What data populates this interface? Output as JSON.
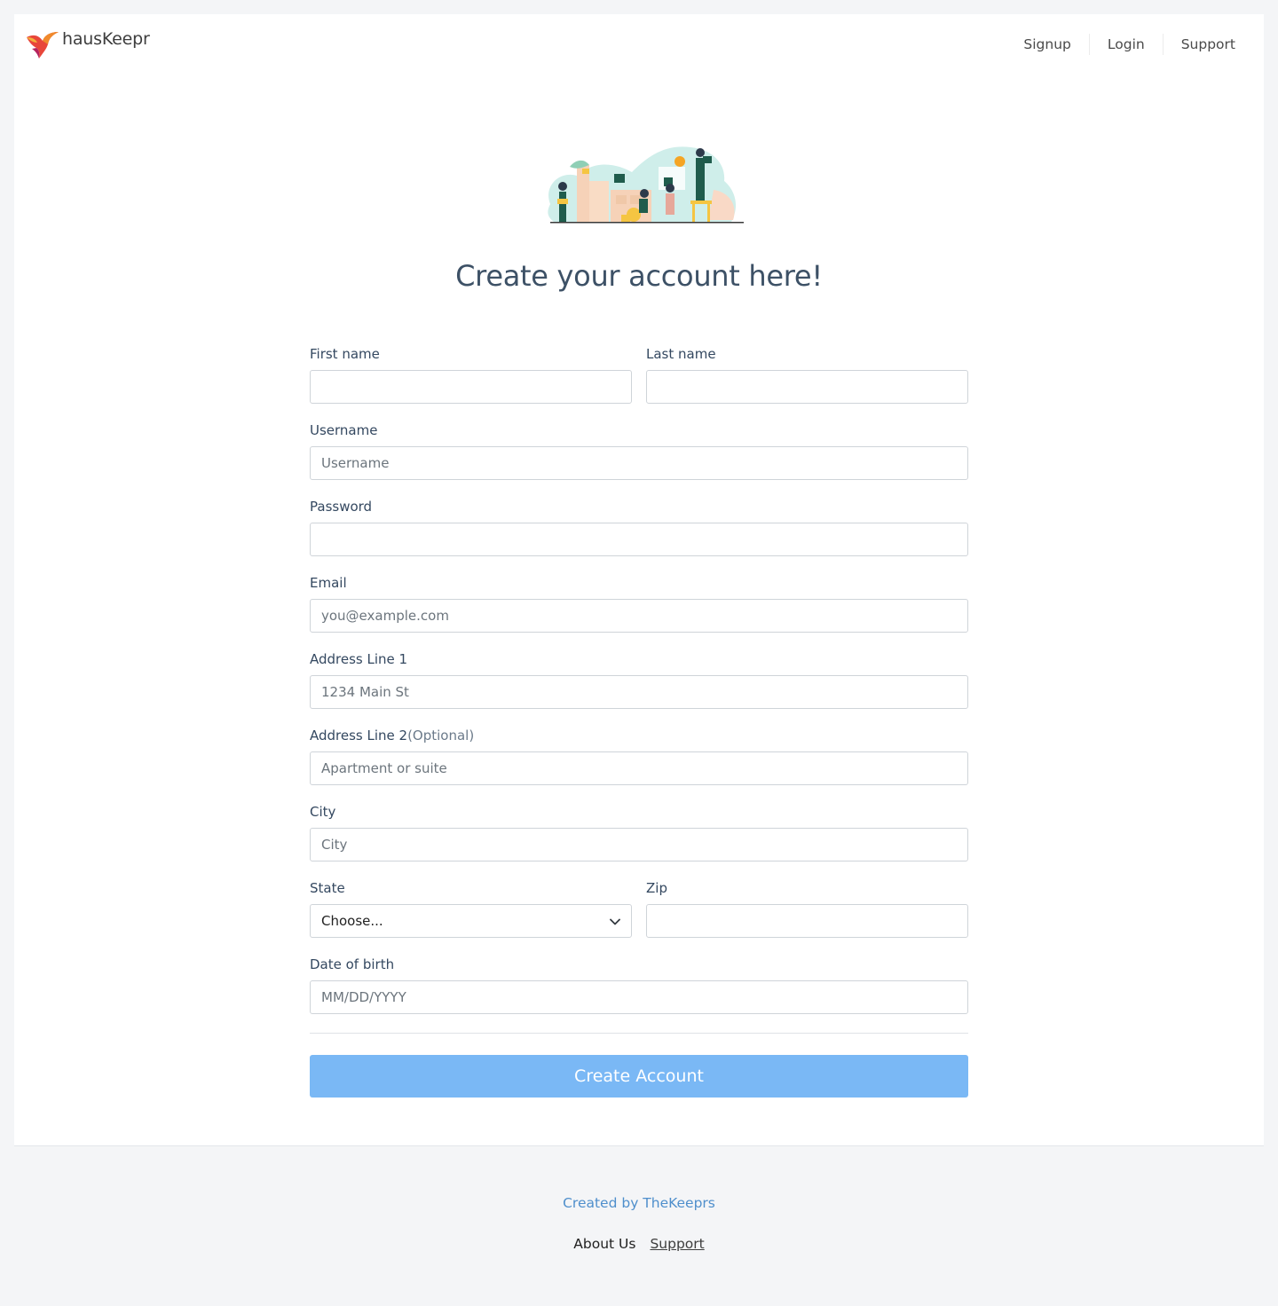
{
  "brand": {
    "name": "hausKeepr",
    "logo_icon": "bird-logo-icon"
  },
  "nav": {
    "items": [
      "Signup",
      "Login",
      "Support"
    ]
  },
  "hero": {
    "illustration": "home-workers-illustration"
  },
  "page_title": "Create your account here!",
  "form": {
    "first_name": {
      "label": "First name",
      "placeholder": ""
    },
    "last_name": {
      "label": "Last name",
      "placeholder": ""
    },
    "username": {
      "label": "Username",
      "placeholder": "Username"
    },
    "password": {
      "label": "Password",
      "placeholder": ""
    },
    "email": {
      "label": "Email",
      "placeholder": "you@example.com"
    },
    "address1": {
      "label": "Address Line 1",
      "placeholder": "1234 Main St"
    },
    "address2": {
      "label": "Address Line 2",
      "optional": "(Optional)",
      "placeholder": "Apartment or suite"
    },
    "city": {
      "label": "City",
      "placeholder": "City"
    },
    "state": {
      "label": "State",
      "selected": "Choose..."
    },
    "zip": {
      "label": "Zip",
      "placeholder": ""
    },
    "dob": {
      "label": "Date of birth",
      "placeholder": "MM/DD/YYYY"
    },
    "submit_label": "Create Account"
  },
  "footer": {
    "credit": "Created by TheKeeprs",
    "about": "About Us",
    "support": "Support"
  },
  "colors": {
    "accent_button": "#7ab8f5",
    "credit_link": "#4f8fcc",
    "title_text": "#3d5166",
    "page_bg": "#f4f5f7"
  }
}
